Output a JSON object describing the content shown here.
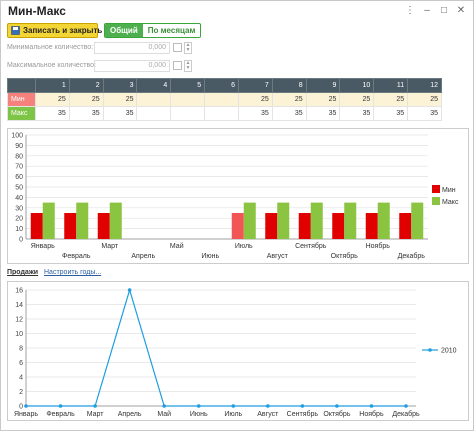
{
  "window": {
    "title": "Мин-Макс"
  },
  "toolbar": {
    "save_close": "Записать и закрыть",
    "segments": [
      "Общий",
      "По месяцам"
    ]
  },
  "fields": {
    "min_label": "Минимальное количество:",
    "min_value": "0,000",
    "max_label": "Максимальное количество:",
    "max_value": "0,000"
  },
  "table": {
    "columns": [
      "1",
      "2",
      "3",
      "4",
      "5",
      "6",
      "7",
      "8",
      "9",
      "10",
      "11",
      "12"
    ],
    "rows": [
      {
        "name": "Мин",
        "values": [
          "25",
          "25",
          "25",
          "",
          "",
          "",
          "25",
          "25",
          "25",
          "25",
          "25",
          "25"
        ]
      },
      {
        "name": "Макс",
        "values": [
          "35",
          "35",
          "35",
          "",
          "",
          "",
          "35",
          "35",
          "35",
          "35",
          "35",
          "35"
        ]
      }
    ]
  },
  "tabs": {
    "sales": "Продажи",
    "setup_years": "Настроить годы..."
  },
  "colors": {
    "min": "#e00000",
    "min_highlight": "#f25555",
    "max": "#8ac440",
    "line": "#1e9ee0",
    "header": "#4a5a64"
  },
  "chart_data": [
    {
      "type": "bar",
      "categories": [
        "Январь",
        "Февраль",
        "Март",
        "Апрель",
        "Май",
        "Июнь",
        "Июль",
        "Август",
        "Сентябрь",
        "Октябрь",
        "Ноябрь",
        "Декабрь"
      ],
      "series": [
        {
          "name": "Мин",
          "values": [
            25,
            25,
            25,
            0,
            0,
            0,
            25,
            25,
            25,
            25,
            25,
            25
          ]
        },
        {
          "name": "Макс",
          "values": [
            35,
            35,
            35,
            0,
            0,
            0,
            35,
            35,
            35,
            35,
            35,
            35
          ]
        }
      ],
      "ylim": [
        0,
        100
      ],
      "yticks": [
        0,
        10,
        20,
        30,
        40,
        50,
        60,
        70,
        80,
        90,
        100
      ],
      "grid": true,
      "legend": "right"
    },
    {
      "type": "line",
      "categories": [
        "Январь",
        "Февраль",
        "Март",
        "Апрель",
        "Май",
        "Июнь",
        "Июль",
        "Август",
        "Сентябрь",
        "Октябрь",
        "Ноябрь",
        "Декабрь"
      ],
      "series": [
        {
          "name": "2010",
          "values": [
            0,
            0,
            0,
            16,
            0,
            0,
            0,
            0,
            0,
            0,
            0,
            0
          ]
        }
      ],
      "ylim": [
        0,
        16
      ],
      "yticks": [
        0,
        2,
        4,
        6,
        8,
        10,
        12,
        14,
        16
      ],
      "grid": true,
      "legend": "right"
    }
  ]
}
